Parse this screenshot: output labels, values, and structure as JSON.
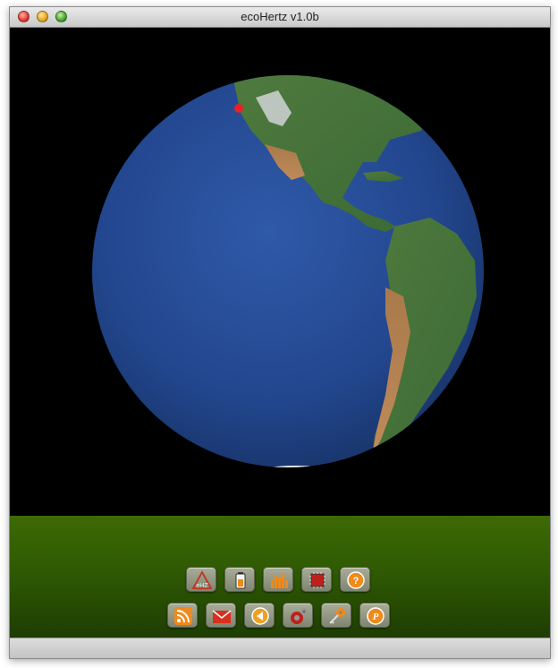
{
  "window": {
    "title": "ecoHertz v1.0b"
  },
  "toolbar_row1": [
    {
      "icon": "ehz-logo-icon",
      "label": "eHZ"
    },
    {
      "icon": "battery-icon"
    },
    {
      "icon": "bar-chart-icon"
    },
    {
      "icon": "chip-icon"
    },
    {
      "icon": "help-icon"
    }
  ],
  "toolbar_row2": [
    {
      "icon": "rss-icon"
    },
    {
      "icon": "mail-icon"
    },
    {
      "icon": "back-arrow-icon"
    },
    {
      "icon": "gears-icon"
    },
    {
      "icon": "key-icon"
    },
    {
      "icon": "paypal-icon"
    }
  ],
  "colors": {
    "accent": "#f08a1a",
    "bottom_panel": "#2f5a03",
    "location_marker": "#e8202a"
  }
}
